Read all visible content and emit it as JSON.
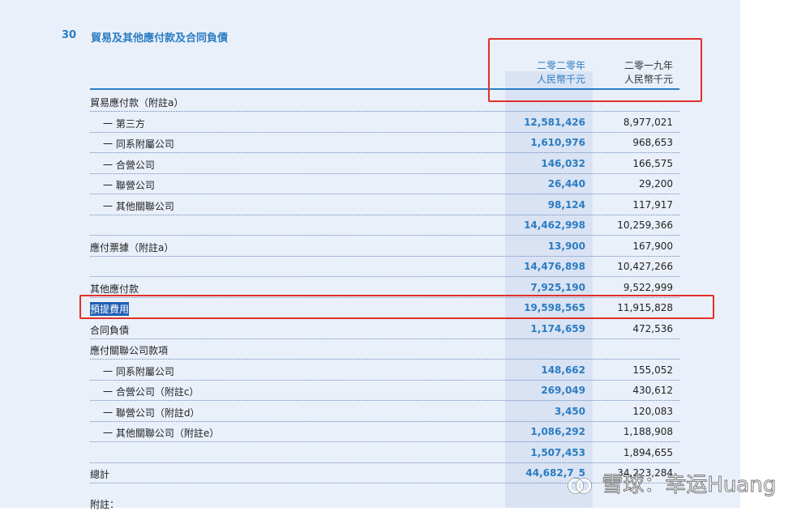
{
  "section": {
    "number": "30",
    "title": "貿易及其他應付款及合同負債"
  },
  "columns": [
    {
      "line1": "二零二零年",
      "line2": "人民幣千元"
    },
    {
      "line1": "二零一九年",
      "line2": "人民幣千元"
    }
  ],
  "rows": [
    {
      "label": "貿易應付款（附註a）",
      "v1": "",
      "v2": ""
    },
    {
      "label": "一 第三方",
      "v1": "12,581,426",
      "v2": "8,977,021"
    },
    {
      "label": "一 同系附屬公司",
      "v1": "1,610,976",
      "v2": "968,653"
    },
    {
      "label": "一 合營公司",
      "v1": "146,032",
      "v2": "166,575"
    },
    {
      "label": "一 聯營公司",
      "v1": "26,440",
      "v2": "29,200"
    },
    {
      "label": "一 其他關聯公司",
      "v1": "98,124",
      "v2": "117,917"
    },
    {
      "label": "",
      "v1": "14,462,998",
      "v2": "10,259,366"
    },
    {
      "label": "應付票據（附註a）",
      "v1": "13,900",
      "v2": "167,900"
    },
    {
      "label": "",
      "v1": "14,476,898",
      "v2": "10,427,266"
    },
    {
      "label": "其他應付款",
      "v1": "7,925,190",
      "v2": "9,522,999"
    },
    {
      "label": "預提費用",
      "v1": "19,598,565",
      "v2": "11,915,828"
    },
    {
      "label": "合同負債",
      "v1": "1,174,659",
      "v2": "472,536"
    },
    {
      "label": "應付關聯公司款項",
      "v1": "",
      "v2": ""
    },
    {
      "label": "一 同系附屬公司",
      "v1": "148,662",
      "v2": "155,052"
    },
    {
      "label": "一 合營公司（附註c）",
      "v1": "269,049",
      "v2": "430,612"
    },
    {
      "label": "一 聯營公司（附註d）",
      "v1": "3,450",
      "v2": "120,083"
    },
    {
      "label": "一 其他關聯公司（附註e）",
      "v1": "1,086,292",
      "v2": "1,188,908"
    },
    {
      "label": "",
      "v1": "1,507,453",
      "v2": "1,894,655"
    },
    {
      "label": "總計",
      "v1": "44,682,7_5",
      "v2": "34,223,284"
    }
  ],
  "notes_label": "附註：",
  "watermark": "雪球：幸运Huang",
  "colors": {
    "accent": "#2b7cc1",
    "highlight_box": "#e0302a",
    "selection": "#1f5fb4"
  }
}
